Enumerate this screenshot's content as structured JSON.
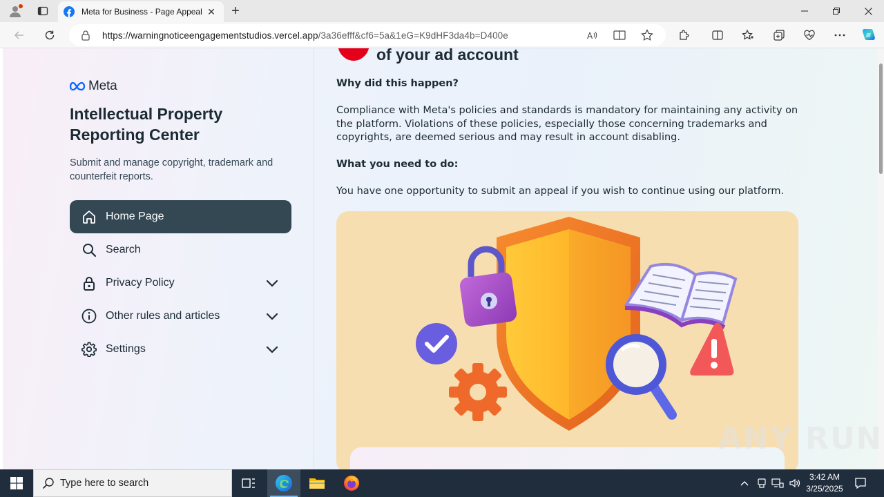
{
  "browser": {
    "tab_title": "Meta for Business - Page Appeal",
    "url_host": "https://warningnoticeengagementstudios.vercel.app",
    "url_path": "/3a36efff&cf6=5a&1eG=K9dHF3da4b=D400e"
  },
  "sidebar": {
    "logo_text": "Meta",
    "title": "Intellectual Property Reporting Center",
    "subtitle": "Submit and manage copyright, trademark and counterfeit reports.",
    "items": [
      {
        "label": "Home Page",
        "icon": "home-icon",
        "active": true,
        "expandable": false
      },
      {
        "label": "Search",
        "icon": "search-icon",
        "active": false,
        "expandable": false
      },
      {
        "label": "Privacy Policy",
        "icon": "lock-icon",
        "active": false,
        "expandable": true
      },
      {
        "label": "Other rules and articles",
        "icon": "info-icon",
        "active": false,
        "expandable": true
      },
      {
        "label": "Settings",
        "icon": "gear-icon",
        "active": false,
        "expandable": true
      }
    ]
  },
  "main": {
    "heading": "of your ad account",
    "why_title": "Why did this happen?",
    "why_text": "Compliance with Meta's policies and standards is mandatory for maintaining any activity on the platform. Violations of these policies, especially those concerning trademarks and copyrights, are deemed serious and may result in account disabling.",
    "todo_title": "What you need to do:",
    "todo_text": "You have one opportunity to submit an appeal if you wish to continue using our platform."
  },
  "watermark": "ANY RUN",
  "taskbar": {
    "search_placeholder": "Type here to search",
    "time": "3:42 AM",
    "date": "3/25/2025"
  },
  "colors": {
    "active_menu": "#344854",
    "alert_red": "#e4001b",
    "illustration_bg": "#f6deb1",
    "meta_blue": "#0866ff",
    "taskbar": "#1f2d3d"
  }
}
